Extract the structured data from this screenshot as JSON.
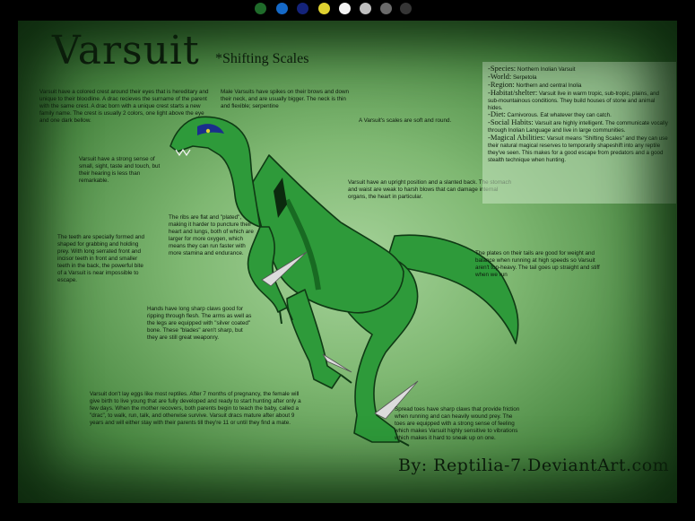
{
  "header": {
    "swatches": [
      {
        "name": "swatch-dark-green",
        "color": "#1f6b2a"
      },
      {
        "name": "swatch-blue",
        "color": "#1569c7"
      },
      {
        "name": "swatch-navy",
        "color": "#14237a"
      },
      {
        "name": "swatch-yellow",
        "color": "#e0d230"
      },
      {
        "name": "swatch-white",
        "color": "#f4f4f4"
      },
      {
        "name": "swatch-light-gray",
        "color": "#bfbfbf"
      },
      {
        "name": "swatch-dark-gray",
        "color": "#6a6a6a"
      },
      {
        "name": "swatch-charcoal",
        "color": "#353535"
      }
    ]
  },
  "sheet": {
    "title": "Varsuit",
    "subtitle": "*Shifting Scales",
    "colors": {
      "background": "#7fb872",
      "body": "#2e9a3a",
      "body_shadow": "#186a22",
      "crest": "#1a2f8c",
      "ink": "#0d1a0d"
    },
    "notes": {
      "crest": "Varsuit have a colored crest around their eyes that is hereditary and unique to their bloodline. A drac recieves the surname of the parent with the same crest. A drac born with a unique crest starts a new family name. The crest is usually 2 colors, one light above the eye and one dark bellow.",
      "spikes": "Male Varsuits have spikes on their brows and down their neck, and are usually bigger. The neck is thin and flexible; serpentine",
      "scales": "A Varsuit's scales are soft and round.",
      "senses": "Varsuit have a strong sense of small, sight, taste and touch, but their hearing is less than remarkable.",
      "posture": "Varsuit have an upright position and a slanted back. The stomach and waist are weak to harsh blows that can damage internal organs, the heart in particular.",
      "ribs": "The ribs are flat and \"plated\", making it harder to puncture their heart and lungs, both of which are larger for more oxygen, which means they can run faster with more stamina and endurance.",
      "teeth": "The teeth are specially formed and shaped for grabbing and holding prey. With long serrated front and incisor teeth in front and smaller teeth in the back, the powerful bite of a Varsuit is near impossible to escape.",
      "tail": "The plates on their tails are good for weight and balance when running at high speeds so Varsuit aren't top-heavy. The tail goes up straight and stiff when we run",
      "hands": "Hands have long sharp claws good for ripping through flesh. The arms as well as the legs are equipped with \"silver coated\" bone. These \"blades\" aren't sharp, but they are still great weaponry.",
      "eggs": "Varsuit don't lay eggs like most reptiles. After 7 months of pregnancy, the female will give birth to live young that are fully developed and ready to start hunting after only a few days. When the mother recovers, both parents begin to teach the baby, called a \"drac\", to walk, run, talk, and otherwise survive. Varsuit dracs mature after about 9 years and will either stay with their parents till they're 11 or until they find a mate.",
      "toes": "Spread toes have sharp claws that provide friction when running and can heavily wound prey. The toes are equipped with a strong sense of feeling which makes Varsuit highly sensitive to vibrations which makes it hard to sneak up on one."
    },
    "info": [
      {
        "key": "-Species:",
        "value": " Northern Inolian Varsuit"
      },
      {
        "key": "-World:",
        "value": " Serpetola"
      },
      {
        "key": "-Region:",
        "value": " Northern and central Inolia"
      },
      {
        "key": "-Habitat/shelter:",
        "value": " Varsuit live in warm tropic, sub-tropic, plains, and sub-mountainous conditions. They build houses of stone and animal hides."
      },
      {
        "key": "-Diet:",
        "value": " Carnivorous. Eat whatever they can catch."
      },
      {
        "key": "-Social Habits:",
        "value": " Varsuit are highly intelligent. The communicate vocally through Inolian Language and live in large communities."
      },
      {
        "key": "-Magical Abilities:",
        "value": " Varsuit means \"Shifting Scales\" and they can use their natural magical reserves to temporarily shapeshift into any reptile they've seen. This makes for a good escape from predators and a good stealth technique when hunting."
      }
    ],
    "credit": "By: Reptilia-7.DeviantArt.com"
  }
}
